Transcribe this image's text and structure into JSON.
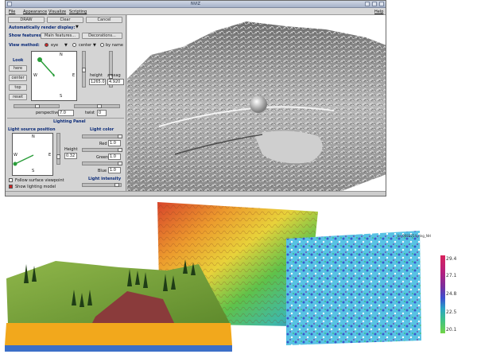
{
  "window": {
    "title": "NVIZ",
    "menu": [
      "File",
      "Appearance",
      "Visualize",
      "Scripting"
    ],
    "help": "Help"
  },
  "panel": {
    "buttons": {
      "draw": "DRAW",
      "clear": "Clear",
      "cancel": "Cancel"
    },
    "auto_render_label": "Automatically render display:",
    "show_features_label": "Show features:",
    "main_features": "Main features...",
    "decorations": "Decorations...",
    "view_method_label": "View method:",
    "view_options": [
      "eye",
      "center",
      "by name"
    ],
    "look_label": "Look",
    "look_buttons": [
      "here",
      "center",
      "top",
      "reset"
    ],
    "compass": {
      "n": "N",
      "s": "S",
      "e": "E",
      "w": "W"
    },
    "height_label": "height",
    "height_value": "1265.0",
    "zexag_label": "z-exag",
    "zexag_value": "4.920",
    "perspective_label": "perspective",
    "perspective_value": "7.0",
    "twist_label": "twist",
    "twist_value": "0"
  },
  "lighting": {
    "title": "Lighting Panel",
    "light_source_label": "Light source position",
    "light_color_label": "Light color",
    "height_label": "Height",
    "height_value": "0.32",
    "red_label": "Red",
    "red_value": "1.0",
    "green_label": "Green",
    "green_value": "1.0",
    "blue_label": "Blue",
    "blue_value": "1.0",
    "light_intensity_label": "Light intensity",
    "follow_label": "Follow surface viewpoint",
    "show_model_label": "Show lighting model",
    "compass": {
      "n": "N",
      "s": "S",
      "e": "E",
      "w": "W"
    }
  },
  "colors": {
    "accent": "#0a2a78",
    "selected": "#cc2222",
    "terrain_gray": "#9a9a9a",
    "grass": "#7fa23a",
    "soil": "#f2a81c",
    "water": "#3b6fc8"
  },
  "legend": {
    "title": "br_0081254_ring_NH",
    "ticks": [
      "29.4",
      "27.1",
      "24.8",
      "22.5",
      "20.1"
    ]
  }
}
